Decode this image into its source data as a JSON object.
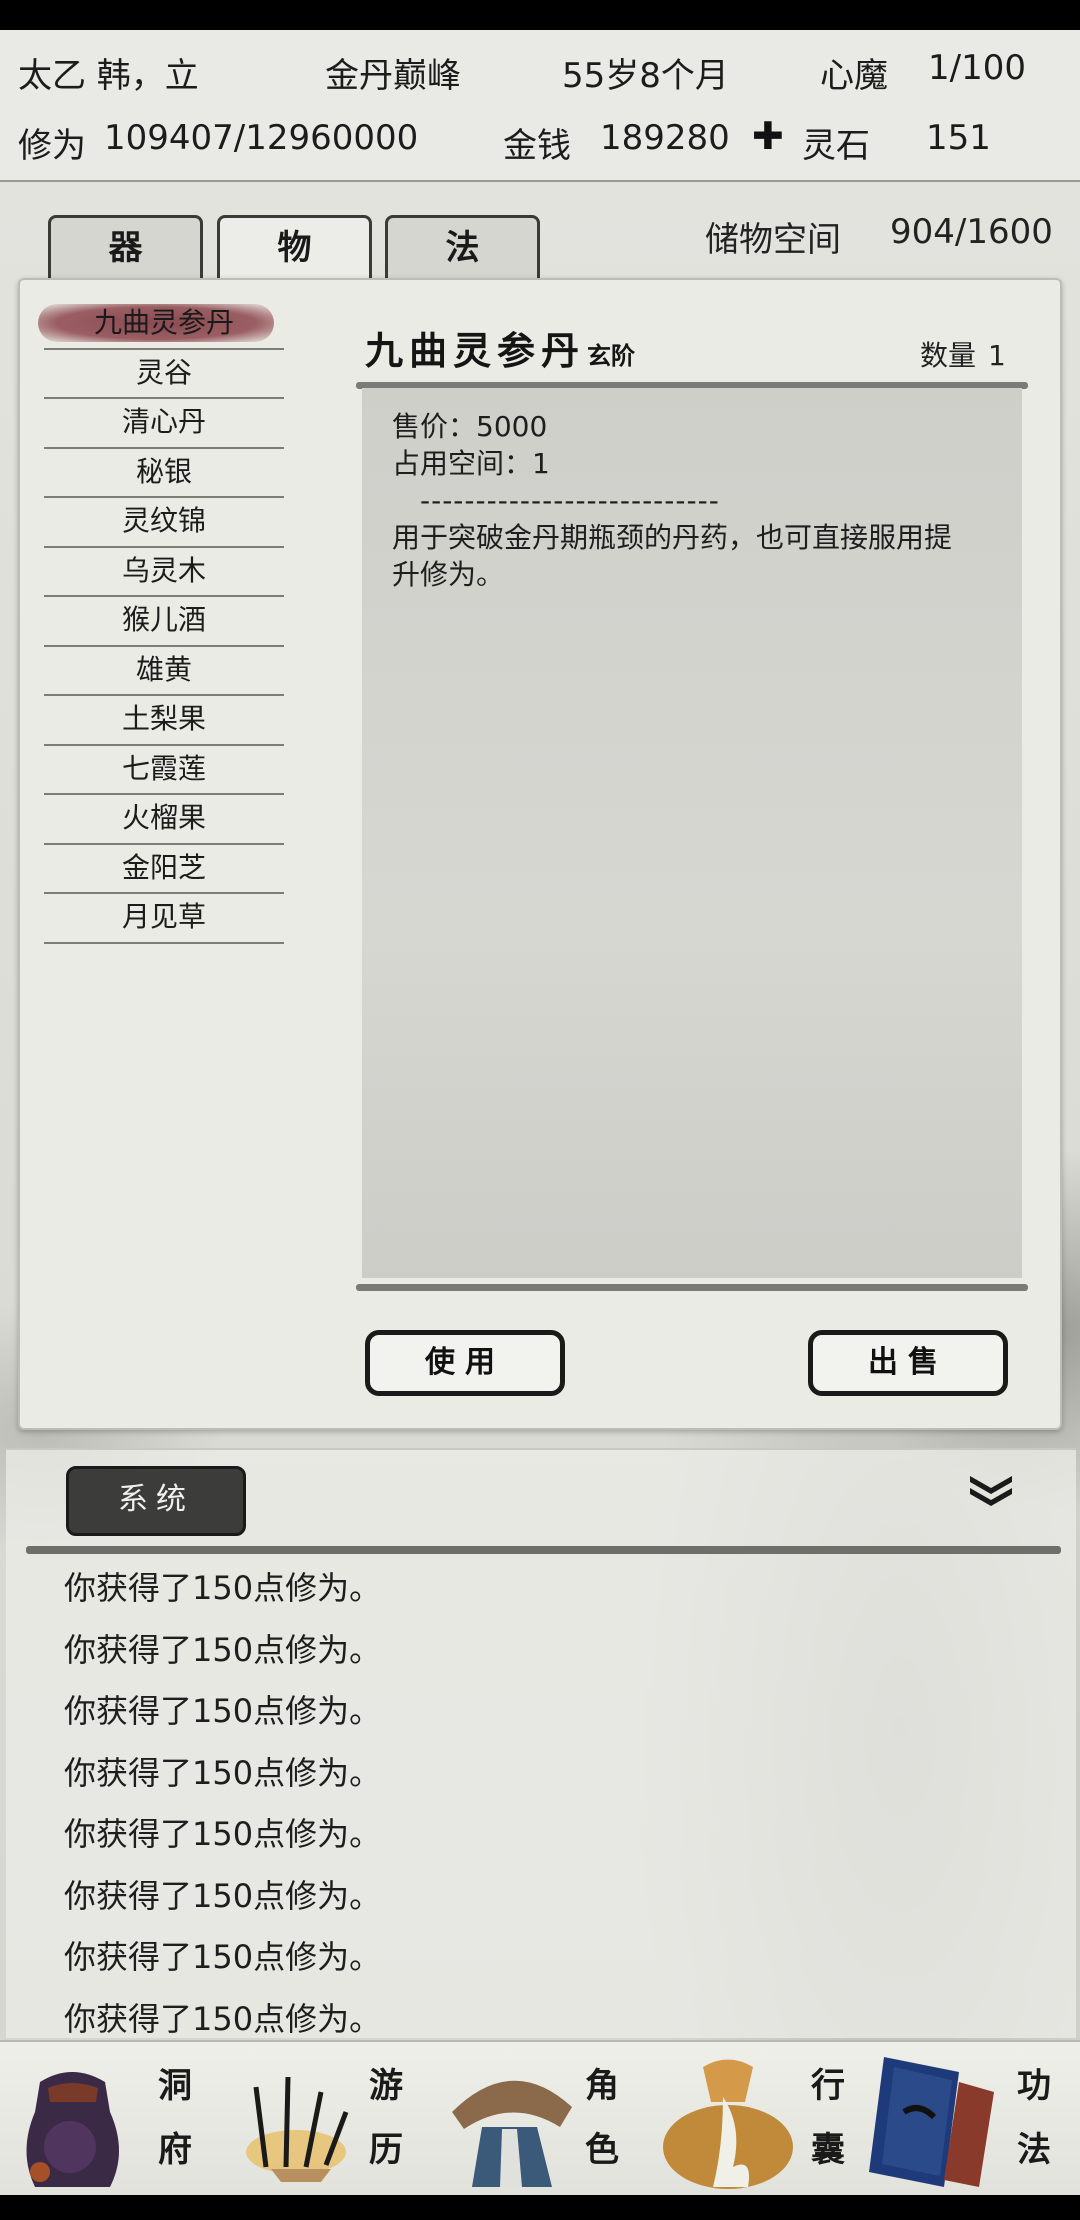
{
  "header": {
    "name": "太乙 韩，立",
    "realm": "金丹巅峰",
    "age": "55岁8个月",
    "heart_demon_label": "心魔",
    "heart_demon_value": "1/100",
    "cultivation_label": "修为",
    "cultivation_value": "109407/12960000",
    "money_label": "金钱",
    "money_value": "189280",
    "spirit_stone_label": "灵石",
    "spirit_stone_value": "151",
    "spirit_stone_icon": "spirit-stone-icon"
  },
  "tabs": [
    {
      "label": "器",
      "active": false
    },
    {
      "label": "物",
      "active": true
    },
    {
      "label": "法",
      "active": false
    }
  ],
  "storage": {
    "label": "储物空间",
    "value": "904/1600"
  },
  "items": [
    {
      "name": "九曲灵参丹",
      "selected": true
    },
    {
      "name": "灵谷"
    },
    {
      "name": "清心丹"
    },
    {
      "name": "秘银"
    },
    {
      "name": "灵纹锦"
    },
    {
      "name": "乌灵木"
    },
    {
      "name": "猴儿酒"
    },
    {
      "name": "雄黄"
    },
    {
      "name": "土梨果"
    },
    {
      "name": "七霞莲"
    },
    {
      "name": "火榴果"
    },
    {
      "name": "金阳芝"
    },
    {
      "name": "月见草"
    }
  ],
  "detail": {
    "title": "九曲灵参丹",
    "grade": "玄阶",
    "qty_label": "数量",
    "qty_value": "1",
    "price": "售价：5000",
    "space": "占用空间：1",
    "divider": "---------------------------",
    "description": "用于突破金丹期瓶颈的丹药，也可直接服用提升修为。"
  },
  "actions": {
    "use": "使用",
    "sell": "出售"
  },
  "log": {
    "tab": "系统",
    "lines": [
      "你获得了150点修为。",
      "你获得了150点修为。",
      "你获得了150点修为。",
      "你获得了150点修为。",
      "你获得了150点修为。",
      "你获得了150点修为。",
      "你获得了150点修为。",
      "你获得了150点修为。"
    ]
  },
  "nav": [
    {
      "label1": "洞",
      "label2": "府",
      "icon": "cave-mansion-icon"
    },
    {
      "label1": "游",
      "label2": "历",
      "icon": "travel-icon"
    },
    {
      "label1": "角",
      "label2": "色",
      "icon": "character-icon"
    },
    {
      "label1": "行",
      "label2": "囊",
      "icon": "bag-icon"
    },
    {
      "label1": "功",
      "label2": "法",
      "icon": "technique-book-icon"
    }
  ]
}
